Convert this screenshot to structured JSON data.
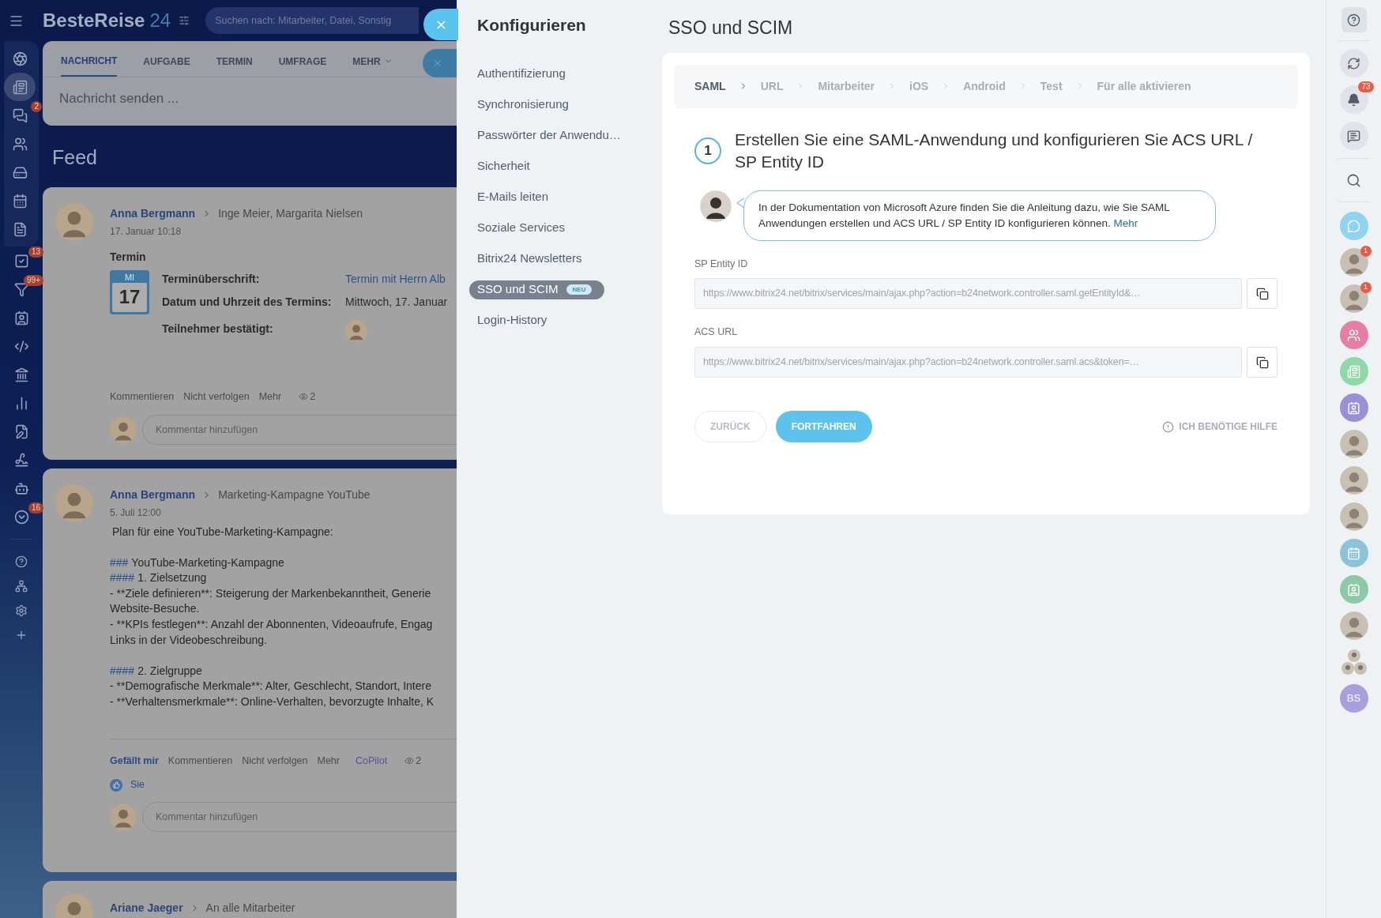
{
  "header": {
    "logo_name": "BesteReise",
    "logo_number": "24",
    "search": {
      "placeholder": "Suchen nach: Mitarbeiter, Datei, Sonstig"
    }
  },
  "left_nav": [
    {
      "selected": false
    },
    {
      "selected": true
    },
    {
      "selected": false,
      "badge": "2"
    },
    {
      "selected": false
    },
    {
      "selected": false
    },
    {
      "selected": false
    },
    {
      "selected": false
    },
    {
      "selected": false,
      "badge": "13"
    },
    {
      "selected": false,
      "badge": "99+"
    },
    {
      "selected": false
    },
    {
      "selected": false
    },
    {
      "selected": false
    },
    {
      "selected": false
    },
    {
      "selected": false
    },
    {
      "selected": false
    },
    {
      "selected": false
    },
    {
      "selected": false,
      "badge": "16"
    },
    {
      "selected": false
    },
    {
      "selected": false
    },
    {
      "selected": false
    },
    {
      "selected": false
    }
  ],
  "composer": {
    "tabs": [
      {
        "label": "NACHRICHT",
        "selected": true
      },
      {
        "label": "AUFGABE",
        "selected": false
      },
      {
        "label": "TERMIN",
        "selected": false
      },
      {
        "label": "UMFRAGE",
        "selected": false
      },
      {
        "label": "MEHR",
        "selected": false
      }
    ],
    "placeholder": "Nachricht senden ..."
  },
  "feed_title": "Feed",
  "posts": [
    {
      "kind": "event",
      "author": "Anna Bergmann",
      "target": "Inge Meier, Margarita Nielsen",
      "date": "17. Januar 10:18",
      "title": "Termin",
      "calendar": {
        "weekday": "MI",
        "day": "17"
      },
      "fields": [
        {
          "kind": "link",
          "label": "Terminüberschrift:",
          "value": "Termin mit Herrn Alb"
        },
        {
          "kind": "text",
          "label": "Datum und Uhrzeit des Termins:",
          "value": "Mittwoch, 17. Januar"
        },
        {
          "kind": "avatar",
          "label": "Teilnehmer bestätigt:"
        }
      ],
      "actions": [
        {
          "kind": "normal",
          "label": "Kommentieren"
        },
        {
          "kind": "normal",
          "label": "Nicht verfolgen"
        },
        {
          "kind": "normal",
          "label": "Mehr"
        }
      ],
      "views": "2",
      "comment_placeholder": "Kommentar hinzufügen"
    },
    {
      "kind": "text",
      "author": "Anna Bergmann",
      "target": "Marketing-Kampagne YouTube",
      "date": "5. Juli 12:00",
      "lines": [
        {
          "kind": "text",
          "text": "Plan für eine YouTube-Marketing-Kampagne:"
        },
        {
          "kind": "blank"
        },
        {
          "kind": "heading",
          "marker": "###",
          "text": "YouTube-Marketing-Kampagne"
        },
        {
          "kind": "heading",
          "marker": "####",
          "text": "1. Zielsetzung"
        },
        {
          "kind": "text",
          "text": "- **Ziele definieren**: Steigerung der Markenbekanntheit, Generie"
        },
        {
          "kind": "text",
          "text": "Website-Besuche."
        },
        {
          "kind": "text",
          "text": "- **KPIs festlegen**: Anzahl der Abonnenten, Videoaufrufe, Engag"
        },
        {
          "kind": "text",
          "text": "Links in der Videobeschreibung."
        },
        {
          "kind": "blank"
        },
        {
          "kind": "heading",
          "marker": "####",
          "text": "2. Zielgruppe"
        },
        {
          "kind": "text",
          "text": "- **Demografische Merkmale**: Alter, Geschlecht, Standort, Intere"
        },
        {
          "kind": "text",
          "text": "- **Verhaltensmerkmale**: Online-Verhalten, bevorzugte Inhalte, K"
        }
      ],
      "actions": [
        {
          "kind": "like",
          "label": "Gefällt mir"
        },
        {
          "kind": "normal",
          "label": "Kommentieren"
        },
        {
          "kind": "normal",
          "label": "Nicht verfolgen"
        },
        {
          "kind": "normal",
          "label": "Mehr"
        },
        {
          "kind": "copilot",
          "label": "CoPilot"
        }
      ],
      "views": "2",
      "likes": "Sie",
      "comment_placeholder": "Kommentar hinzufügen"
    },
    {
      "kind": "partial",
      "author": "Ariane Jaeger",
      "target": "An alle Mitarbeiter"
    }
  ],
  "settings_menu": {
    "title": "Konfigurieren",
    "items": [
      {
        "label": "Authentifizierung",
        "selected": false
      },
      {
        "label": "Synchronisierung",
        "selected": false
      },
      {
        "label": "Passwörter der Anwendu…",
        "selected": false
      },
      {
        "label": "Sicherheit",
        "selected": false
      },
      {
        "label": "E-Mails leiten",
        "selected": false
      },
      {
        "label": "Soziale Services",
        "selected": false
      },
      {
        "label": "Bitrix24 Newsletters",
        "selected": false
      },
      {
        "label": "SSO und SCIM",
        "selected": true,
        "badge": "NEU"
      },
      {
        "label": "Login-History",
        "selected": false
      }
    ]
  },
  "page": {
    "title": "SSO und SCIM",
    "steps": [
      {
        "label": "SAML",
        "selected": true
      },
      {
        "label": "URL",
        "selected": false
      },
      {
        "label": "Mitarbeiter",
        "selected": false
      },
      {
        "label": "iOS",
        "selected": false
      },
      {
        "label": "Android",
        "selected": false
      },
      {
        "label": "Test",
        "selected": false
      },
      {
        "label": "Für alle aktivieren",
        "selected": false
      }
    ],
    "step_number": "1",
    "step_heading": "Erstellen Sie eine SAML-Anwendung und konfigurieren Sie ACS URL / SP Entity ID",
    "hint": {
      "text": "In der Dokumentation von Microsoft Azure finden Sie die Anleitung dazu, wie Sie SAML Anwendungen erstellen und ACS URL / SP Entity ID konfigurieren können.",
      "link": "Mehr"
    },
    "fields": [
      {
        "label": "SP Entity ID",
        "value": "https://www.bitrix24.net/bitrix/services/main/ajax.php?action=b24network.controller.saml.getEntityId&…"
      },
      {
        "label": "ACS URL",
        "value": "https://www.bitrix24.net/bitrix/services/main/ajax.php?action=b24network.controller.saml.acs&token=…"
      }
    ],
    "back_button": "ZURÜCK",
    "next_button": "FORTFAHREN",
    "help_link": "ICH BENÖTIGE HILFE"
  },
  "right_bar": {
    "tools": [
      {
        "kind": "help"
      },
      {
        "kind": "copilot"
      },
      {
        "kind": "bell",
        "badge": "73"
      },
      {
        "kind": "chats"
      },
      {
        "kind": "search"
      }
    ],
    "contacts": [
      {
        "kind": "chat",
        "color": "#8fd3f0"
      },
      {
        "kind": "avatar",
        "badge": "1"
      },
      {
        "kind": "avatar",
        "badge": "1"
      },
      {
        "kind": "team",
        "color": "#e57ea0"
      },
      {
        "kind": "news",
        "color": "#8ed9a8"
      },
      {
        "kind": "card",
        "color": "#9b8fd6"
      },
      {
        "kind": "avatar"
      },
      {
        "kind": "avatar"
      },
      {
        "kind": "avatar"
      },
      {
        "kind": "calendar",
        "color": "#8cc3d8"
      },
      {
        "kind": "card",
        "color": "#8cc9a8"
      },
      {
        "kind": "avatar"
      },
      {
        "kind": "group"
      },
      {
        "kind": "initials",
        "text": "BS",
        "color": "#a99fdc"
      }
    ]
  }
}
